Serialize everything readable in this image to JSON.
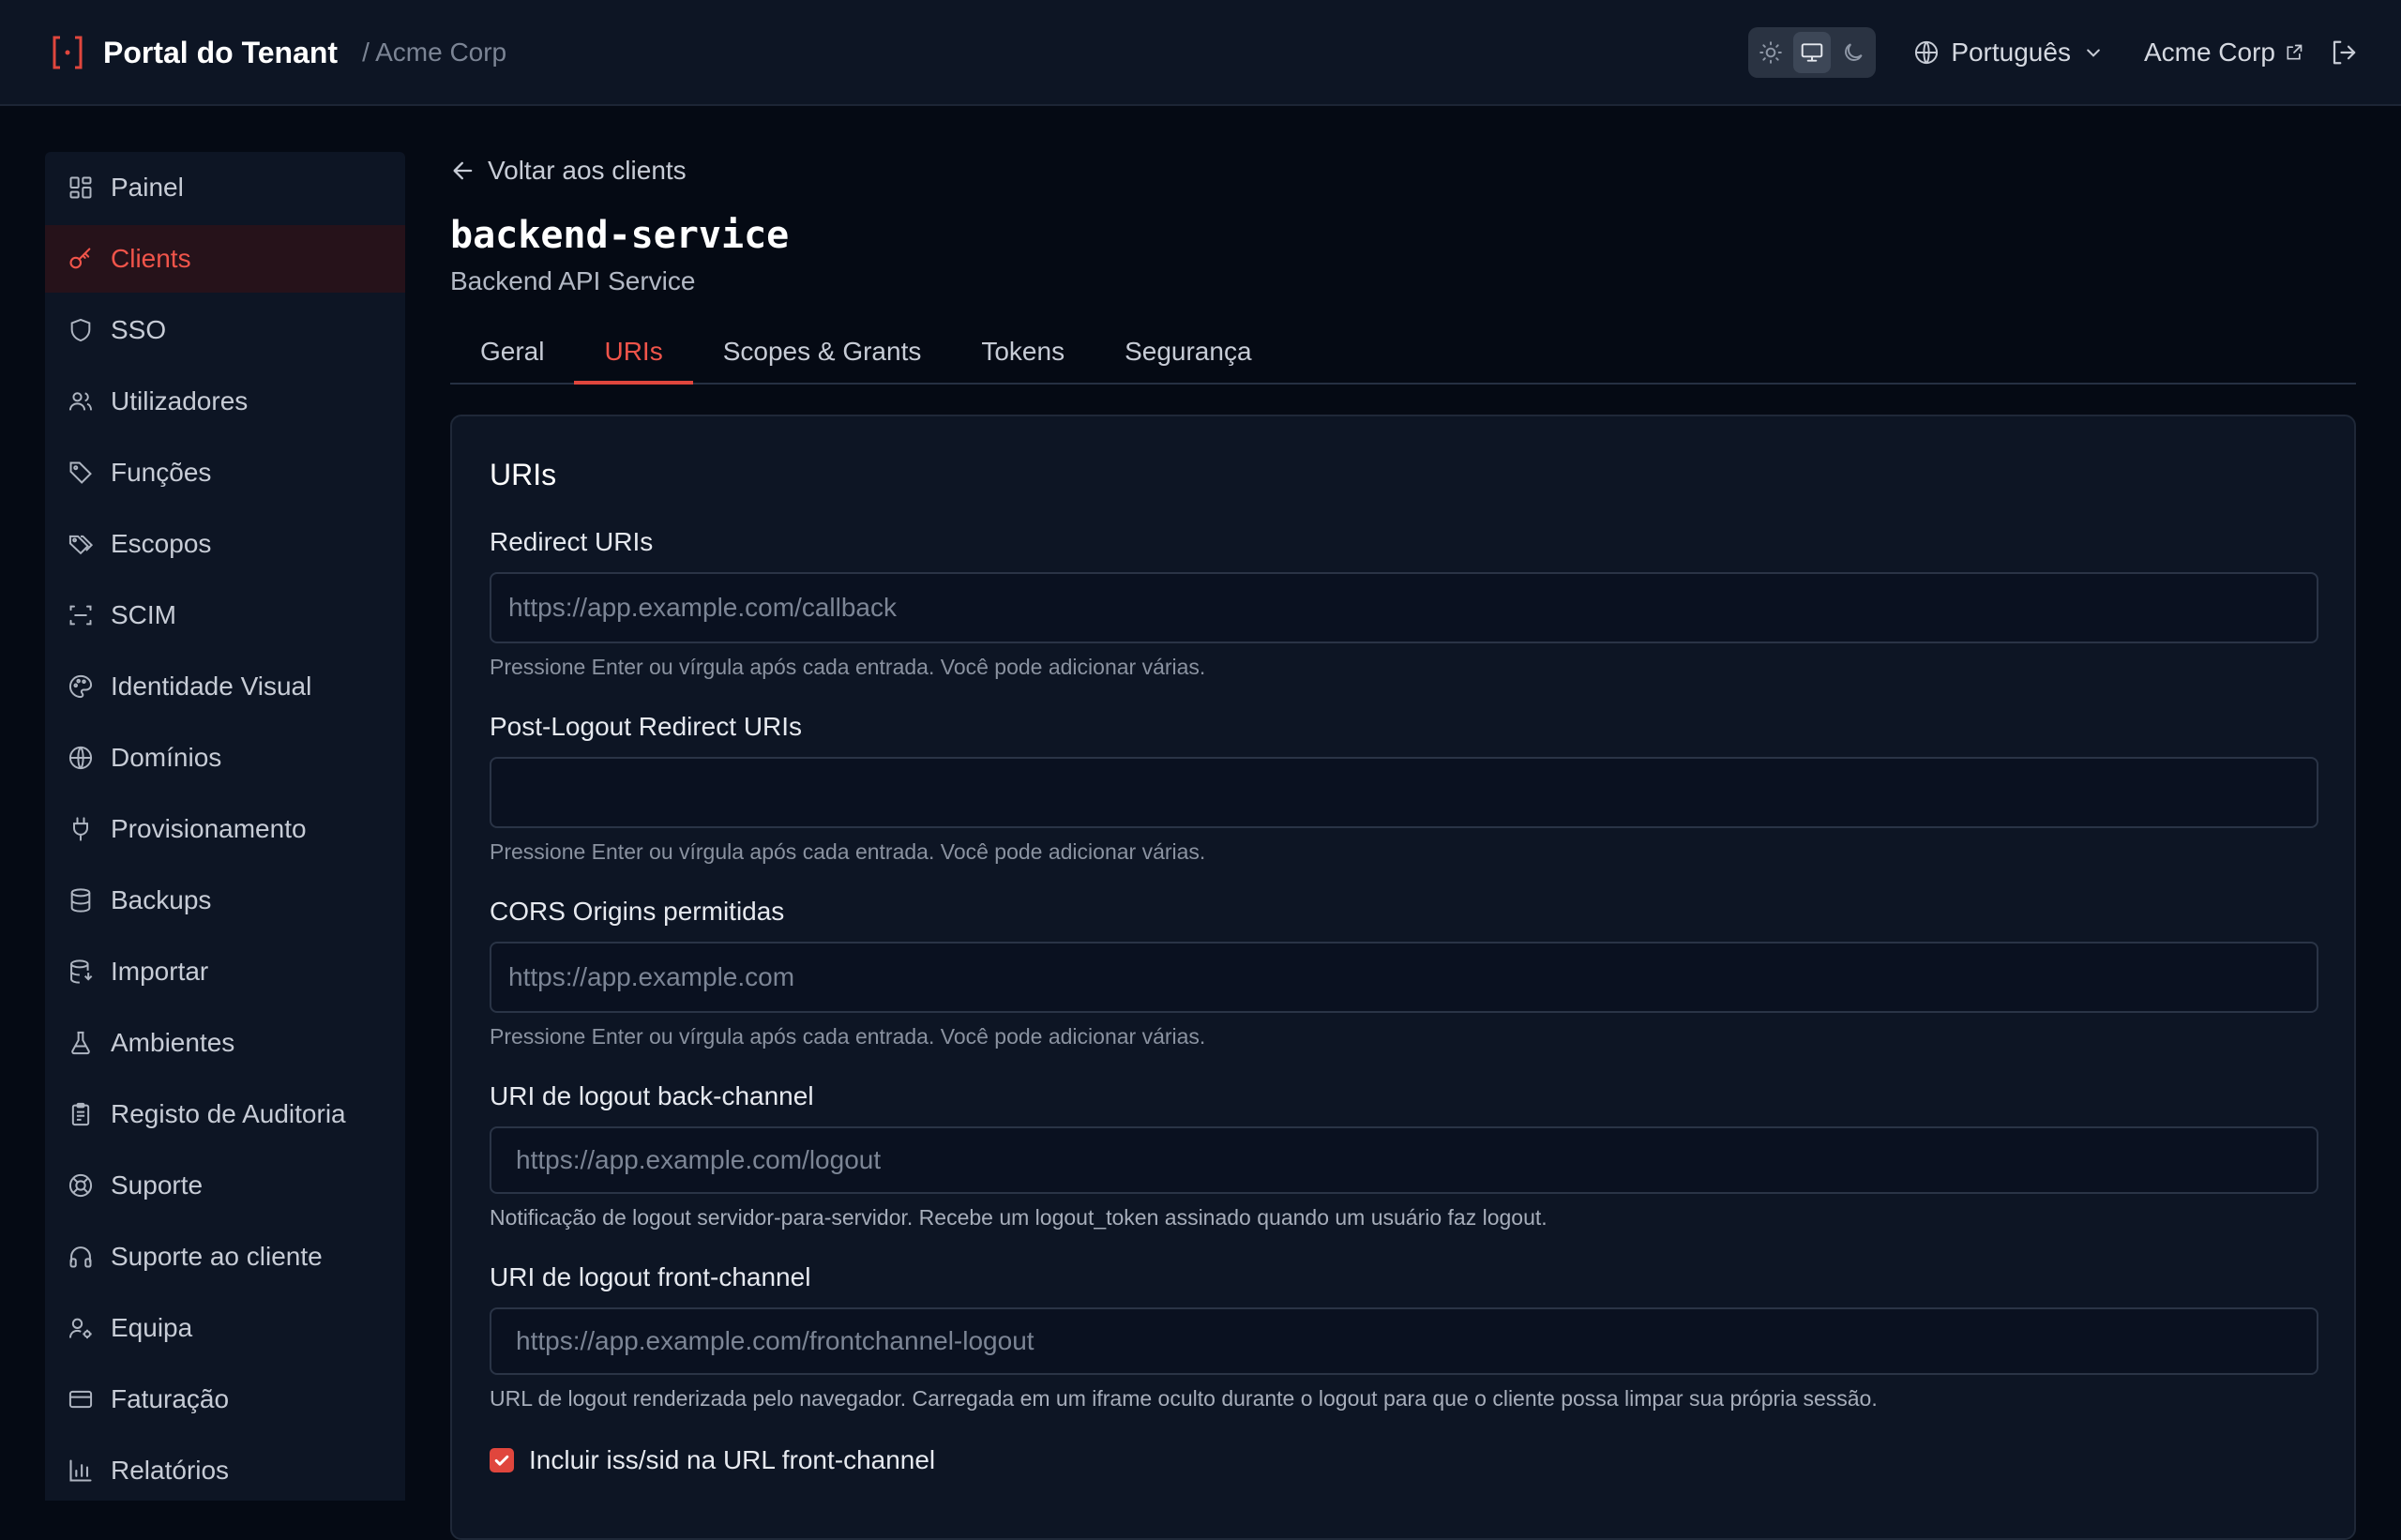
{
  "header": {
    "app_title": "Portal do Tenant",
    "tenant_crumb": "/ Acme Corp",
    "language": "Português",
    "org_link": "Acme Corp",
    "theme_modes": [
      "sun-icon",
      "monitor-icon",
      "moon-icon"
    ],
    "theme_active": "monitor-icon"
  },
  "sidebar": {
    "items": [
      {
        "label": "Painel",
        "icon": "dashboard-icon"
      },
      {
        "label": "Clients",
        "icon": "key-icon",
        "active": true
      },
      {
        "label": "SSO",
        "icon": "shield-icon"
      },
      {
        "label": "Utilizadores",
        "icon": "users-icon"
      },
      {
        "label": "Funções",
        "icon": "tag-icon"
      },
      {
        "label": "Escopos",
        "icon": "tags-icon"
      },
      {
        "label": "SCIM",
        "icon": "scan-icon"
      },
      {
        "label": "Identidade Visual",
        "icon": "palette-icon"
      },
      {
        "label": "Domínios",
        "icon": "globe-icon"
      },
      {
        "label": "Provisionamento",
        "icon": "plug-icon"
      },
      {
        "label": "Backups",
        "icon": "database-icon"
      },
      {
        "label": "Importar",
        "icon": "database-import-icon"
      },
      {
        "label": "Ambientes",
        "icon": "flask-icon"
      },
      {
        "label": "Registo de Auditoria",
        "icon": "clipboard-icon"
      },
      {
        "label": "Suporte",
        "icon": "life-buoy-icon"
      },
      {
        "label": "Suporte ao cliente",
        "icon": "headphones-icon"
      },
      {
        "label": "Equipa",
        "icon": "user-cog-icon"
      },
      {
        "label": "Faturação",
        "icon": "credit-card-icon"
      },
      {
        "label": "Relatórios",
        "icon": "bar-chart-icon"
      }
    ]
  },
  "main": {
    "back_label": "Voltar aos clients",
    "client_id": "backend-service",
    "client_name": "Backend API Service",
    "tabs": [
      {
        "label": "Geral"
      },
      {
        "label": "URIs",
        "active": true
      },
      {
        "label": "Scopes & Grants"
      },
      {
        "label": "Tokens"
      },
      {
        "label": "Segurança"
      }
    ],
    "card_title": "URIs",
    "fields": {
      "redirect": {
        "label": "Redirect URIs",
        "placeholder": "https://app.example.com/callback",
        "hint": "Pressione Enter ou vírgula após cada entrada. Você pode adicionar várias."
      },
      "post_logout": {
        "label": "Post-Logout Redirect URIs",
        "placeholder": "",
        "hint": "Pressione Enter ou vírgula após cada entrada. Você pode adicionar várias."
      },
      "cors": {
        "label": "CORS Origins permitidas",
        "placeholder": "https://app.example.com",
        "hint": "Pressione Enter ou vírgula após cada entrada. Você pode adicionar várias."
      },
      "backchannel": {
        "label": "URI de logout back-channel",
        "placeholder": "https://app.example.com/logout",
        "hint": "Notificação de logout servidor-para-servidor. Recebe um logout_token assinado quando um usuário faz logout."
      },
      "frontchannel": {
        "label": "URI de logout front-channel",
        "placeholder": "https://app.example.com/frontchannel-logout",
        "hint": "URL de logout renderizada pelo navegador. Carregada em um iframe oculto durante o logout para que o cliente possa limpar sua própria sessão."
      }
    },
    "include_iss_sid": {
      "label": "Incluir iss/sid na URL front-channel",
      "checked": true
    }
  },
  "colors": {
    "accent": "#e0463d",
    "background": "#050a14",
    "surface": "#0d1524"
  }
}
